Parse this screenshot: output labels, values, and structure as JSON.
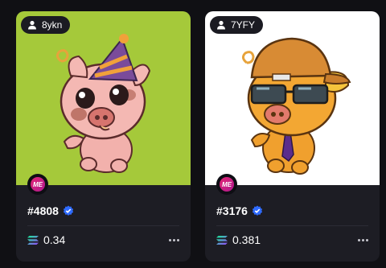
{
  "cards": [
    {
      "owner": "8ykn",
      "title": "#4808",
      "price": "0.34",
      "art_bg": "#a5c93a",
      "marketplace_icon": "magic-eden-icon",
      "marketplace_label": "ME"
    },
    {
      "owner": "7YFY",
      "title": "#3176",
      "price": "0.381",
      "art_bg": "#ffffff",
      "marketplace_icon": "magic-eden-icon",
      "marketplace_label": "ME"
    }
  ],
  "colors": {
    "page_bg": "#101014",
    "card_bg": "#1d1d24",
    "verified": "#2f6bff",
    "sol_gradient_top": "#14f195",
    "sol_gradient_bottom": "#9945ff"
  }
}
